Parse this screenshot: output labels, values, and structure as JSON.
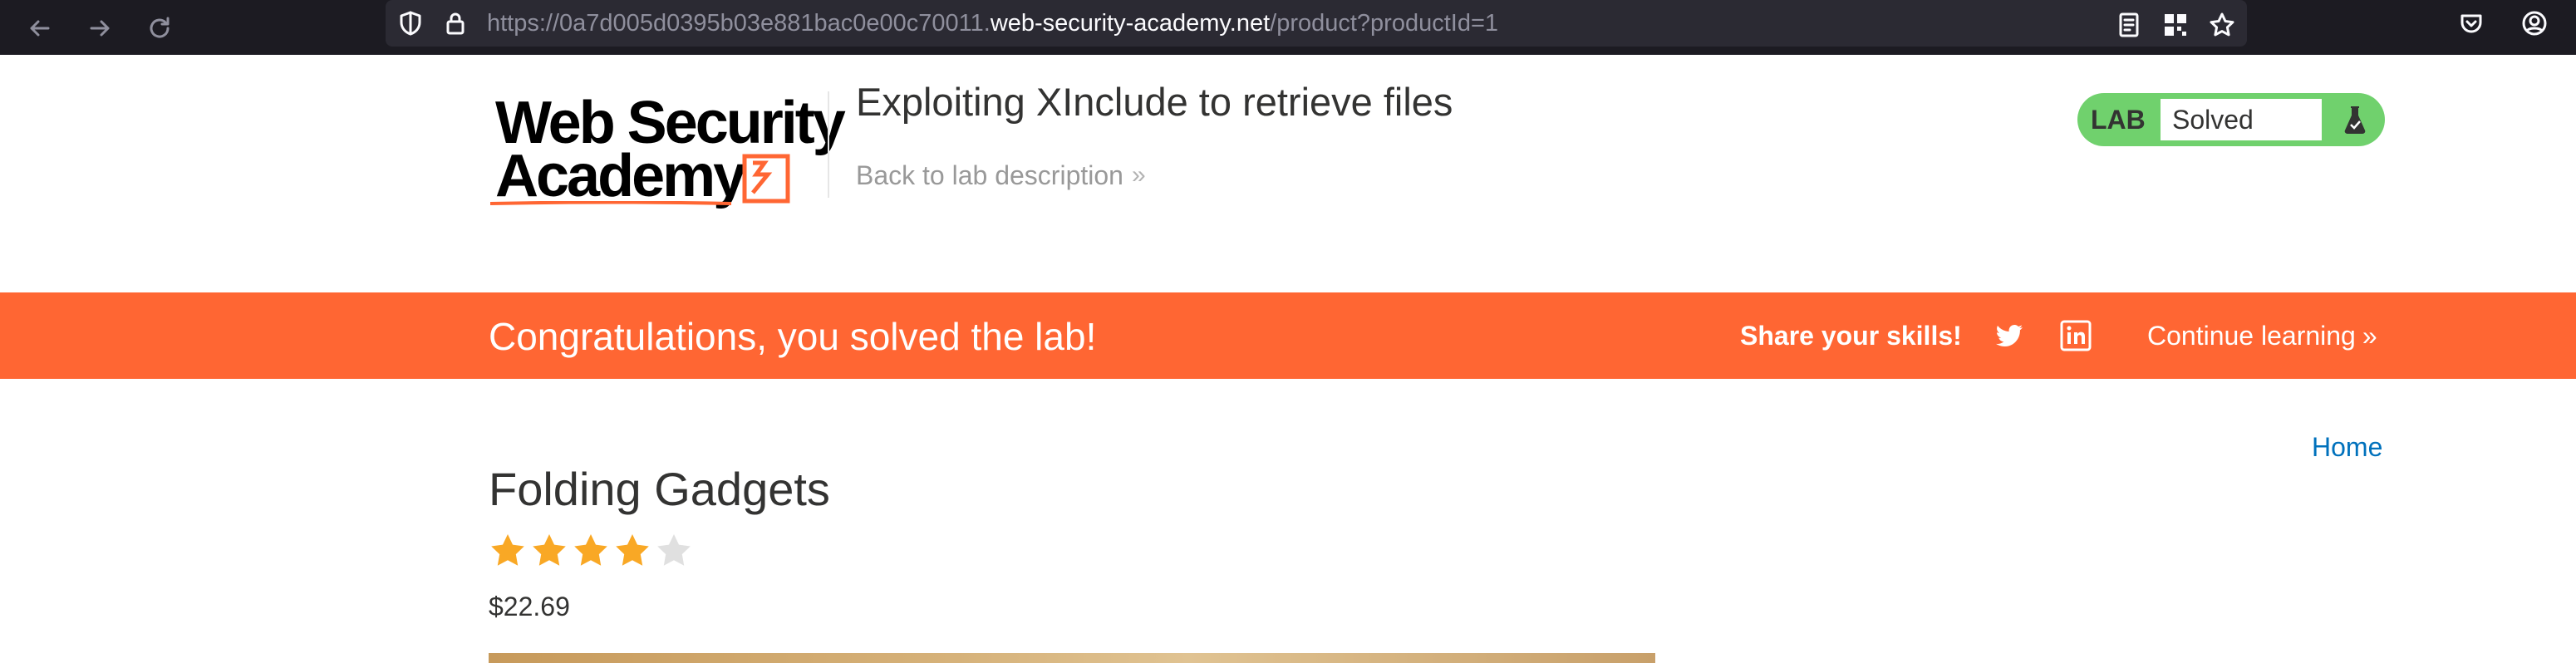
{
  "browser": {
    "url_prefix": "https://0a7d005d0395b03e881bac0e00c70011.",
    "url_host": "web-security-academy.net",
    "url_path": "/product?productId=1",
    "icons": [
      "back-arrow-icon",
      "forward-arrow-icon",
      "reload-icon",
      "shield-icon",
      "lock-icon",
      "reader-mode-icon",
      "qr-code-icon",
      "bookmark-star-icon",
      "pocket-icon",
      "account-icon"
    ]
  },
  "header": {
    "logo_line1": "Web Security",
    "logo_line2": "Academy",
    "lab_title": "Exploiting XInclude to retrieve files",
    "back_link": "Back to lab description",
    "lab_badge": {
      "label": "LAB",
      "status": "Solved",
      "icon": "flask-icon",
      "color": "#70d16d"
    }
  },
  "banner": {
    "message": "Congratulations, you solved the lab!",
    "share_label": "Share your skills!",
    "social": [
      "twitter-icon",
      "linkedin-icon"
    ],
    "continue_label": "Continue learning",
    "color": "#ff6633"
  },
  "nav": {
    "home": "Home"
  },
  "product": {
    "title": "Folding Gadgets",
    "rating": 4,
    "rating_max": 5,
    "price": "$22.69"
  },
  "colors": {
    "accent": "#ff6633",
    "link": "#0071bc",
    "star_filled": "#f9a825",
    "star_empty": "#e0e0e0"
  }
}
